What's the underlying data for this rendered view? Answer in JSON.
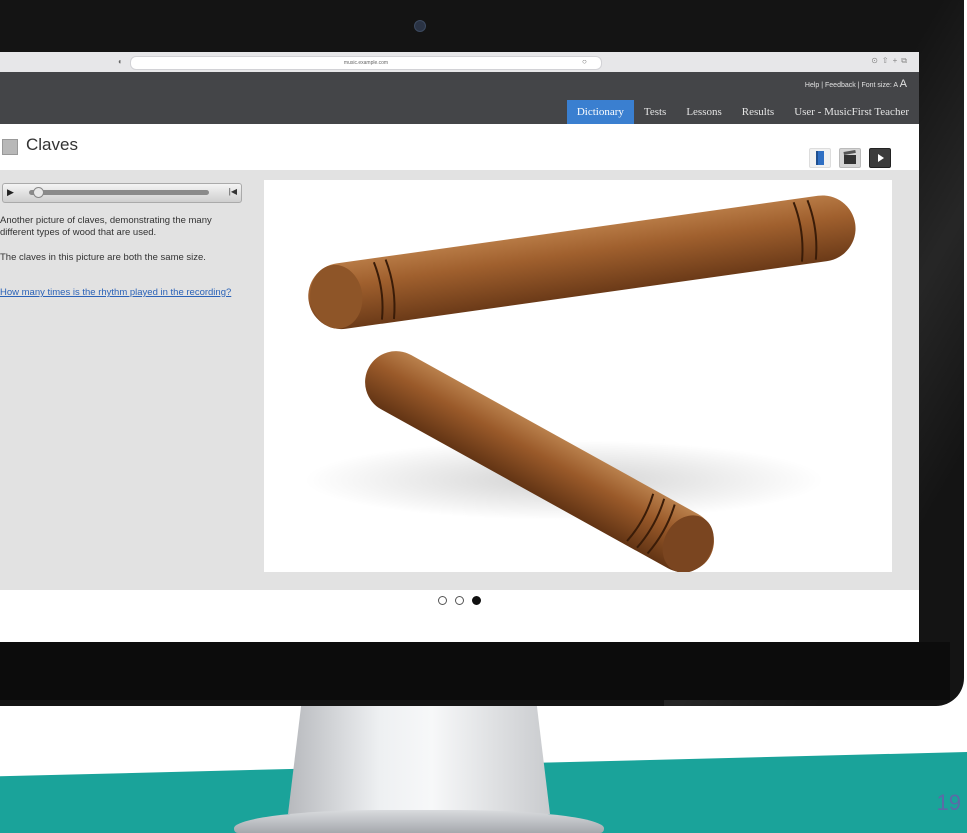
{
  "browser": {
    "url": "music.example.com"
  },
  "header": {
    "help": "Help",
    "feedback": "Feedback",
    "font_size_label": "Font size:",
    "font_small": "A",
    "font_large": "A"
  },
  "tabs": [
    {
      "label": "Dictionary",
      "active": true
    },
    {
      "label": "Tests",
      "active": false
    },
    {
      "label": "Lessons",
      "active": false
    },
    {
      "label": "Results",
      "active": false
    },
    {
      "label": "User - MusicFirst Teacher",
      "active": false
    }
  ],
  "page": {
    "title": "Claves"
  },
  "description": {
    "line1": "Another picture of claves, demonstrating the many different types of wood that are used.",
    "line2": "The claves in this picture are both the same size.",
    "question": "How many times is the rhythm played in the recording?"
  },
  "pager": {
    "count": 3,
    "active_index": 2
  },
  "slide_number": "19",
  "colors": {
    "header_bg": "#444548",
    "active_tab": "#3a7fd0",
    "link": "#2b63b8",
    "floor": "#1aa39a"
  }
}
